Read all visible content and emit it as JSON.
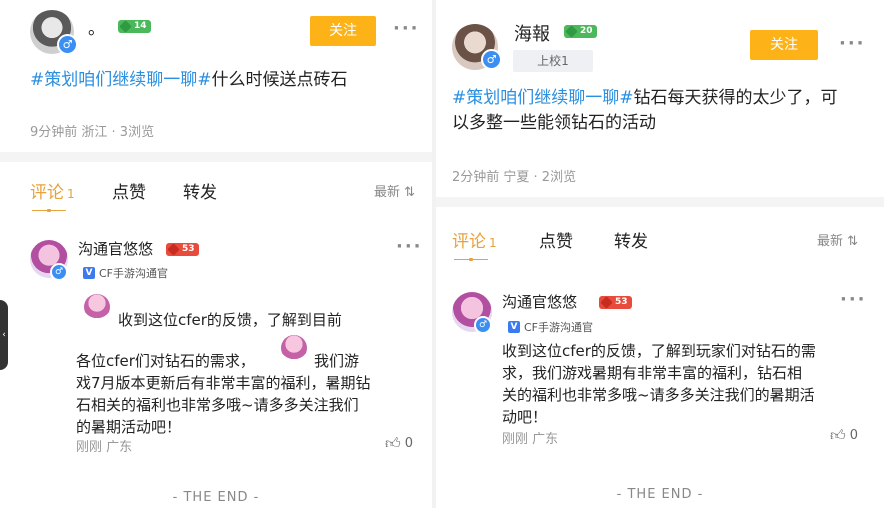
{
  "left": {
    "author": {
      "name": "。",
      "level": "14"
    },
    "follow_label": "关注",
    "post": {
      "tag": "#策划咱们继续聊一聊#",
      "text": "什么时候送点砖石"
    },
    "meta": "9分钟前 浙江 · 3浏览",
    "tabs": {
      "comment": "评论",
      "comment_count": "1",
      "like": "点赞",
      "share": "转发",
      "sort": "最新"
    },
    "reply": {
      "name": "沟通官悠悠",
      "level": "53",
      "verify": "CF手游沟通官",
      "line1": "收到这位cfer的反馈，了解到目前",
      "line2a": "各位cfer们对钻石的需求，",
      "line2b": "我们游",
      "rest": "戏7月版本更新后有非常丰富的福利，暑期钻石相关的福利也非常多哦~请多多关注我们的暑期活动吧！",
      "meta": "刚刚  广东",
      "likes": "0"
    },
    "end": "- THE END -"
  },
  "right": {
    "author": {
      "name": "海報",
      "level": "20",
      "rank": "上校1"
    },
    "follow_label": "关注",
    "post": {
      "tag": "#策划咱们继续聊一聊#",
      "text": "钻石每天获得的太少了，可以多整一些能领钻石的活动"
    },
    "meta": "2分钟前 宁夏 · 2浏览",
    "tabs": {
      "comment": "评论",
      "comment_count": "1",
      "like": "点赞",
      "share": "转发",
      "sort": "最新"
    },
    "reply": {
      "name": "沟通官悠悠",
      "level": "53",
      "verify": "CF手游沟通官",
      "text": "收到这位cfer的反馈，了解到玩家们对钻石的需求，我们游戏暑期有非常丰富的福利，钻石相关的福利也非常多哦~请多多关注我们的暑期活动吧！",
      "meta": "刚刚  广东",
      "likes": "0"
    },
    "end": "- THE END -"
  },
  "colors": {
    "accent": "#fdb318",
    "tag": "#2b8fe0",
    "tab_active": "#e6a23c"
  }
}
